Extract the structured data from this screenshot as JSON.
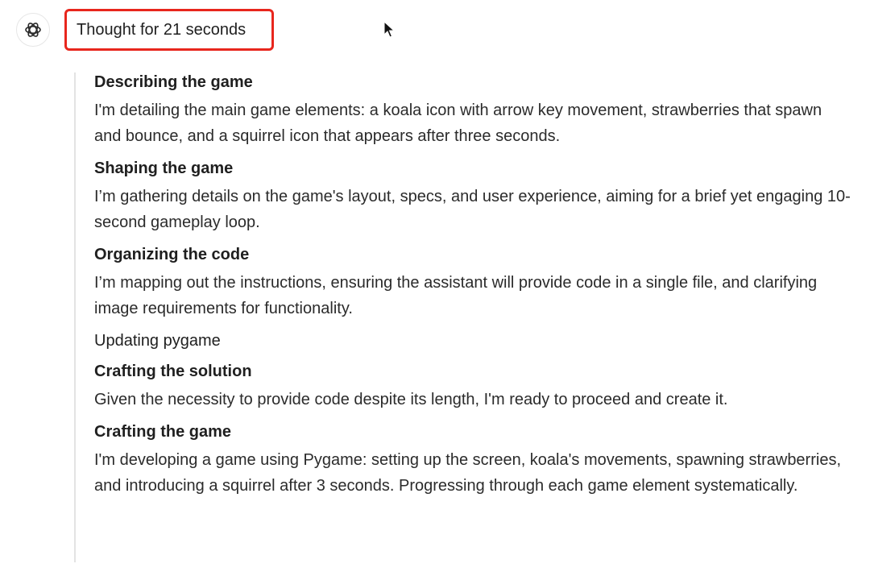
{
  "header": {
    "avatar_icon": "openai-logo-icon",
    "thought_label": "Thought for 21 seconds",
    "highlight_color": "#e8261d"
  },
  "steps": [
    {
      "title": "Describing the game",
      "body": "I'm detailing the main game elements: a koala icon with arrow key movement, strawberries that spawn and bounce, and a squirrel icon that appears after three seconds."
    },
    {
      "title": "Shaping the game",
      "body": "I’m gathering details on the game's layout, specs, and user experience, aiming for a brief yet engaging 10-second gameplay loop."
    },
    {
      "title": "Organizing the code",
      "body": "I’m mapping out the instructions, ensuring the assistant will provide code in a single file, and clarifying image requirements for functionality."
    },
    {
      "title": "Updating pygame"
    },
    {
      "title": "Crafting the solution",
      "body": "Given the necessity to provide code despite its length, I'm ready to proceed and create it."
    },
    {
      "title": "Crafting the game",
      "body": "I'm developing a game using Pygame: setting up the screen, koala's movements, spawning strawberries, and introducing a squirrel after 3 seconds. Progressing through each game element systematically."
    }
  ]
}
